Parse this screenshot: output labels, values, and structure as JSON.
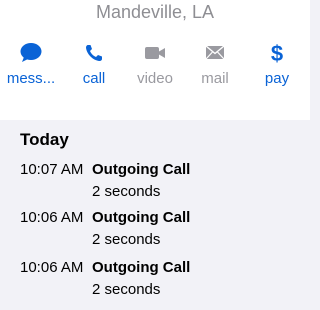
{
  "header": {
    "location": "Mandeville, LA"
  },
  "actions": [
    {
      "label": "mess...",
      "icon": "message-bubble-icon",
      "enabled": true
    },
    {
      "label": "call",
      "icon": "phone-icon",
      "enabled": true
    },
    {
      "label": "video",
      "icon": "video-camera-icon",
      "enabled": false
    },
    {
      "label": "mail",
      "icon": "envelope-icon",
      "enabled": false
    },
    {
      "label": "pay",
      "icon": "dollar-sign-icon",
      "enabled": true
    }
  ],
  "colors": {
    "accent": "#0a63d6",
    "disabled": "#9a9aa0",
    "header_text": "#8e8e93",
    "background": "#f2f2f7"
  },
  "history": {
    "section_title": "Today",
    "calls": [
      {
        "time": "10:07 AM",
        "type": "Outgoing Call",
        "duration": "2 seconds"
      },
      {
        "time": "10:06 AM",
        "type": "Outgoing Call",
        "duration": "2 seconds"
      },
      {
        "time": "10:06 AM",
        "type": "Outgoing Call",
        "duration": "2 seconds"
      }
    ]
  }
}
